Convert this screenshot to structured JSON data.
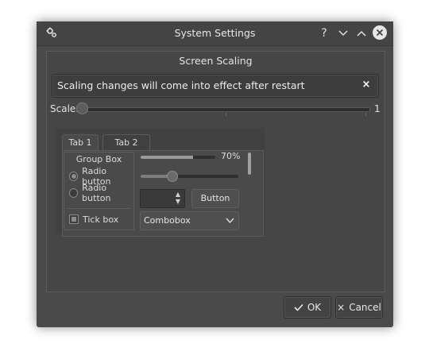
{
  "window": {
    "title": "System Settings",
    "titlebar_buttons": [
      {
        "name": "help-icon",
        "glyph": "?"
      },
      {
        "name": "minimize-icon",
        "glyph": "chevron-down"
      },
      {
        "name": "maximize-icon",
        "glyph": "chevron-up"
      },
      {
        "name": "close-icon",
        "glyph": "x-circle"
      }
    ]
  },
  "section": {
    "heading": "Screen Scaling",
    "banner_text": "Scaling changes will come into effect after restart",
    "banner_close": "×"
  },
  "scale": {
    "label": "Scale:",
    "value_label": "1",
    "value": 1
  },
  "tabs": [
    {
      "label": "Tab 1",
      "active": true
    },
    {
      "label": "Tab 2",
      "active": false
    }
  ],
  "groupbox": {
    "title": "Group Box",
    "radios": [
      {
        "label": "Radio button",
        "checked": true
      },
      {
        "label": "Radio button",
        "checked": false
      }
    ],
    "checkbox": {
      "label": "Tick box",
      "checked": true
    }
  },
  "progress": {
    "value_text": "70%",
    "fraction": 0.7
  },
  "slider": {
    "fraction": 0.32
  },
  "spinbox": {
    "value": ""
  },
  "button": {
    "label": "Button"
  },
  "combobox": {
    "selected": "Combobox"
  },
  "footer": {
    "ok_label": "OK",
    "cancel_label": "Cancel"
  },
  "colors": {
    "window_bg": "#4a4a4a",
    "frame_bg": "#464646",
    "text": "#dcdcdc"
  }
}
